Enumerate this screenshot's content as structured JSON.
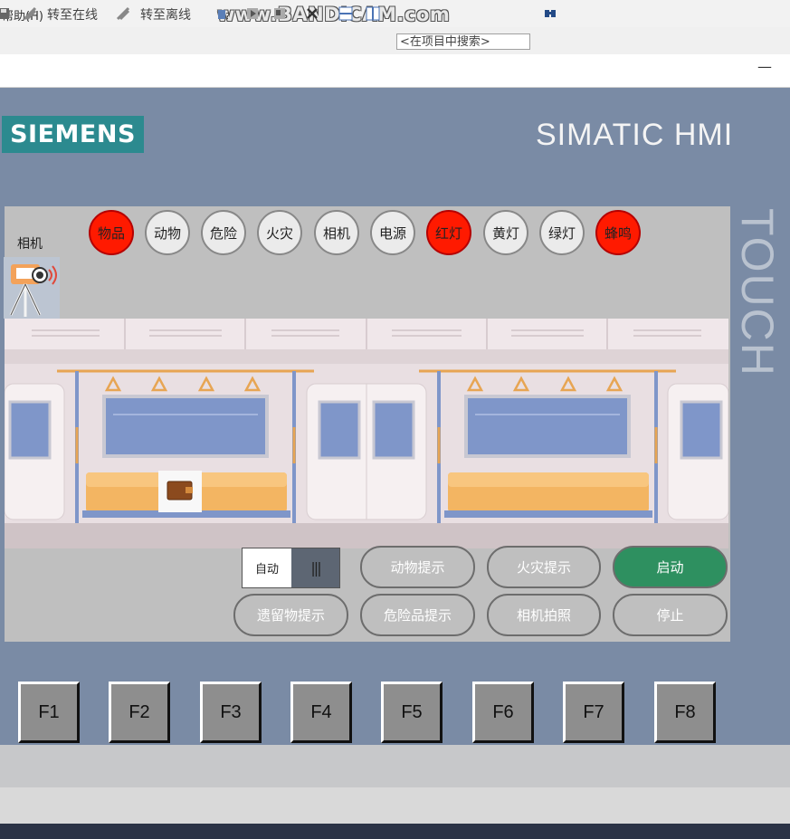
{
  "menubar": {
    "help": "帮助(H)"
  },
  "watermark": "www.BANDICAM.com",
  "toolbar": {
    "go_online": "转至在线",
    "go_offline": "转至离线",
    "search_placeholder": "<在项目中搜索>"
  },
  "window": {
    "minimize": "—"
  },
  "hmi": {
    "brand": "SIEMENS",
    "model": "SIMATIC HMI",
    "side_label": "TOUCH",
    "camera_label": "相机",
    "indicators": [
      {
        "label": "物品",
        "state": "on",
        "color": "#ff1a00"
      },
      {
        "label": "动物",
        "state": "off"
      },
      {
        "label": "危险",
        "state": "off"
      },
      {
        "label": "火灾",
        "state": "off"
      },
      {
        "label": "相机",
        "state": "off"
      },
      {
        "label": "电源",
        "state": "off"
      },
      {
        "label": "红灯",
        "state": "on",
        "color": "#ff1a00"
      },
      {
        "label": "黄灯",
        "state": "off"
      },
      {
        "label": "绿灯",
        "state": "off"
      },
      {
        "label": "蜂鸣",
        "state": "on",
        "color": "#ff1a00"
      }
    ],
    "mode_switch": {
      "label": "自动",
      "knob": "|||"
    },
    "buttons": {
      "animal_hint": "动物提示",
      "fire_hint": "火灾提示",
      "start": "启动",
      "left_item_hint": "遗留物提示",
      "dangerous_hint": "危险品提示",
      "camera_photo": "相机拍照",
      "stop": "停止"
    },
    "start_color": "#2e9060",
    "function_keys": [
      "F1",
      "F2",
      "F3",
      "F4",
      "F5",
      "F6",
      "F7",
      "F8"
    ]
  }
}
